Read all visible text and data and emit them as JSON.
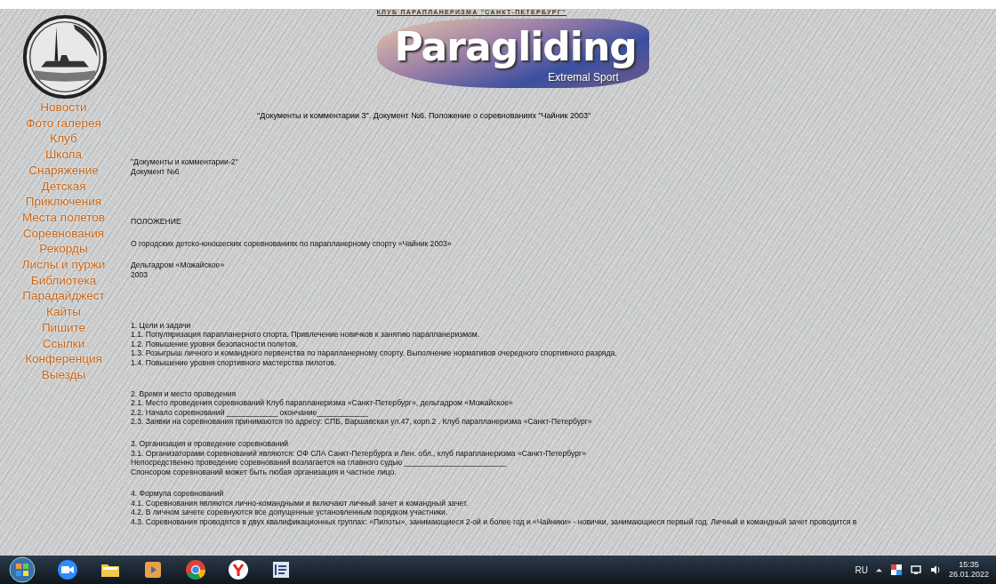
{
  "header": {
    "club": "КЛУБ ПАРАПЛАНЕРИЗМА \"САНКТ-ПЕТЕРБУРГ\"",
    "logo_title": "Paragliding",
    "logo_subtitle": "Extremal Sport"
  },
  "nav": [
    "Новости",
    "Фото галерея",
    "Клуб",
    "Школа",
    "Снаряжение",
    "Детская",
    "Приключения",
    "Места полетов",
    "Соревнования",
    "Рекорды",
    "Лислы и пуржи",
    "Библиотека",
    "Парадайджест",
    "Кайты",
    "Пишите",
    "Ссылки",
    "Конференция",
    "Выезды"
  ],
  "page_title": "\"Документы и комментарии 3\". Документ №6. Положение о соревнованиях \"Чайник 2003\"",
  "blocks": [
    {
      "kind": "lead",
      "lines": [
        "\"Документы и комментарии-2\"",
        "Документ №6"
      ]
    },
    {
      "kind": "lead",
      "lines": [
        "ПОЛОЖЕНИЕ"
      ]
    },
    {
      "kind": "para",
      "lines": [
        "О городских детско-юношеских соревнованиях по парапланерному спорту «Чайник 2003»"
      ]
    },
    {
      "kind": "para",
      "lines": [
        "Дельтадром «Можайское»",
        "2003"
      ]
    },
    {
      "kind": "lead",
      "lines": [
        "1. Цели и задачи",
        "1.1. Популяризация парапланерного спорта. Привлечение новичков к занятию парапланеризмом.",
        "1.2. Повышение уровня безопасности полетов.",
        "1.3. Розыгрыш личного и командного первенства по парапланерному спорту. Выполнение нормативов очередного спортивного разряда.",
        "1.4. Повышение уровня спортивного мастерства пилотов."
      ]
    },
    {
      "kind": "section",
      "lines": [
        "2. Время и место проведения",
        "2.1. Место проведения соревнований Клуб парапланеризма «Санкт-Петербург», дельтадром «Можайское»",
        "2.2. Начало соревнований ____________ окончание____________",
        "2.3. Заявки на соревнования принимаются по адресу: СПБ, Варшавская ул.47, корп.2 . Клуб парапланеризма «Санкт-Петербург»"
      ]
    },
    {
      "kind": "para",
      "lines": [
        "3. Организация и проведение соревнований",
        "3.1. Организаторами соревнований являются: ОФ СЛА Санкт-Петербурга и Лен. обл., клуб парапланеризма «Санкт-Петербург»",
        "Непосредственно проведение соревнований возлагается на главного судью ________________________",
        "Спонсором соревнований может быть любая организация и частное лицо."
      ]
    },
    {
      "kind": "para",
      "lines": [
        "4. Формула соревнований",
        "4.1. Соревнования являются лично-командными и включают личный зачет и командный зачет.",
        "4.2. В личном зачете соревнуются все допущенные установленным порядком участники.",
        "4.3. Соревнования проводятся в двух квалификационных группах: «Пилоты», занимающиеся 2-ой и более год и «Чайники» - новички, занимающиеся первый год. Личный и командный зачет проводится в"
      ]
    }
  ],
  "taskbar": {
    "language": "RU",
    "time": "15:35",
    "date": "26.01.2022"
  }
}
